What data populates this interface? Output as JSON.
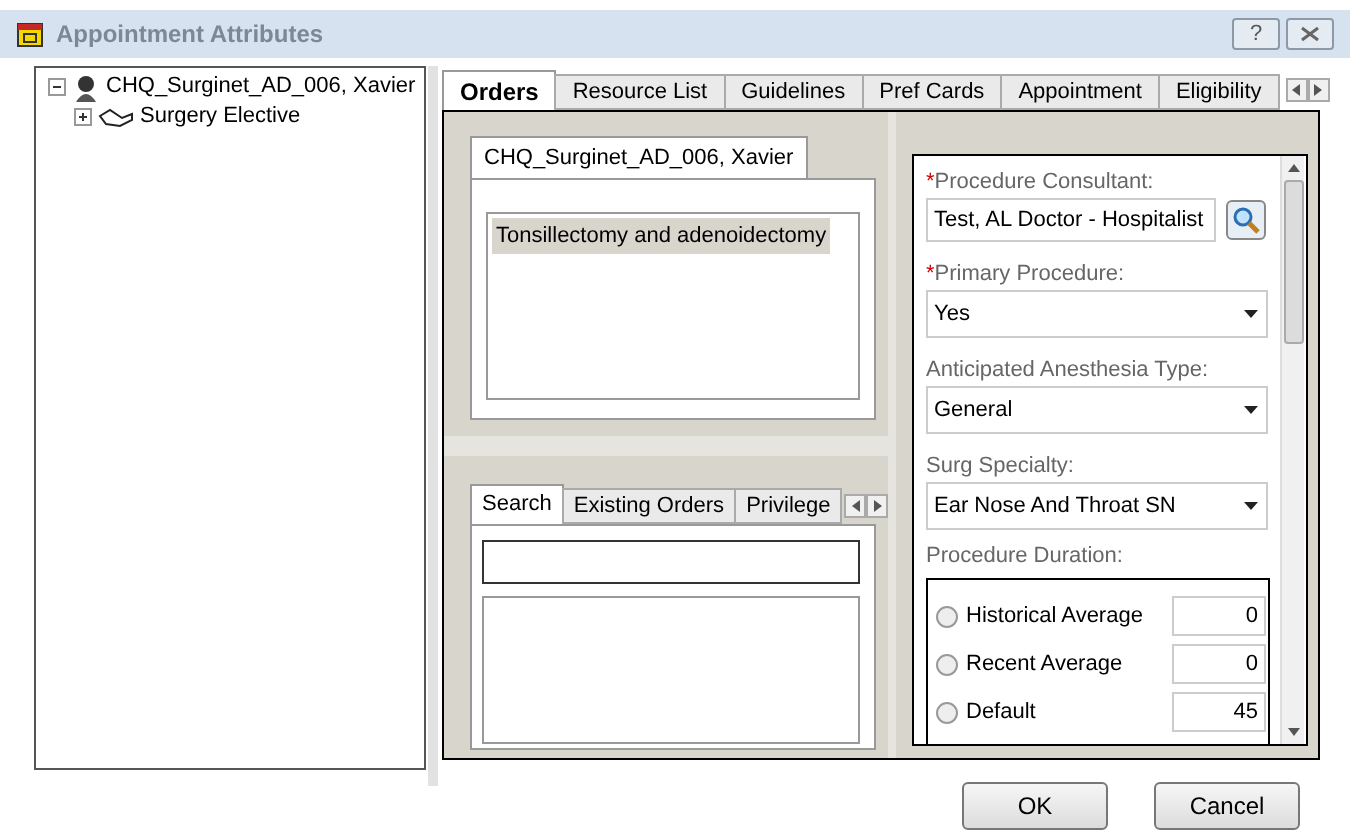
{
  "window": {
    "title": "Appointment Attributes",
    "help_button": "?"
  },
  "tree": [
    {
      "label": "CHQ_Surginet_AD_006, Xavier",
      "expanded": true,
      "children": [
        {
          "label": "Surgery Elective",
          "expanded": false
        }
      ]
    }
  ],
  "tabs": [
    {
      "label": "Orders",
      "selected": true
    },
    {
      "label": "Resource List",
      "selected": false
    },
    {
      "label": "Guidelines",
      "selected": false
    },
    {
      "label": "Pref Cards",
      "selected": false
    },
    {
      "label": "Appointment",
      "selected": false
    },
    {
      "label": "Eligibility",
      "selected": false
    }
  ],
  "orders_panel": {
    "patient_tab": "CHQ_Surginet_AD_006, Xavier",
    "orders": [
      {
        "label": "Tonsillectomy and adenoidectomy",
        "selected": true
      }
    ]
  },
  "search_panel": {
    "tabs": [
      {
        "label": "Search",
        "selected": true
      },
      {
        "label": "Existing Orders",
        "selected": false
      },
      {
        "label": "Privilege",
        "selected": false
      }
    ]
  },
  "form": {
    "fields": [
      {
        "kind": "lookup",
        "required_mark": "*",
        "label": "Procedure Consultant:",
        "value": "Test, AL Doctor - Hospitalist"
      },
      {
        "kind": "dropdown",
        "required_mark": "*",
        "label": "Primary Procedure:",
        "value": "Yes"
      },
      {
        "kind": "dropdown",
        "label": "Anticipated Anesthesia Type:",
        "value": "General"
      },
      {
        "kind": "dropdown",
        "label": "Surg Specialty:",
        "value": "Ear Nose And Throat SN"
      }
    ],
    "duration": {
      "label": "Procedure Duration:",
      "options": [
        {
          "label": "Historical Average",
          "value": "0",
          "selected": false
        },
        {
          "label": "Recent Average",
          "value": "0",
          "selected": false
        },
        {
          "label": "Default",
          "value": "45",
          "selected": false
        }
      ]
    }
  },
  "buttons": [
    {
      "label": "OK"
    },
    {
      "label": "Cancel"
    }
  ]
}
